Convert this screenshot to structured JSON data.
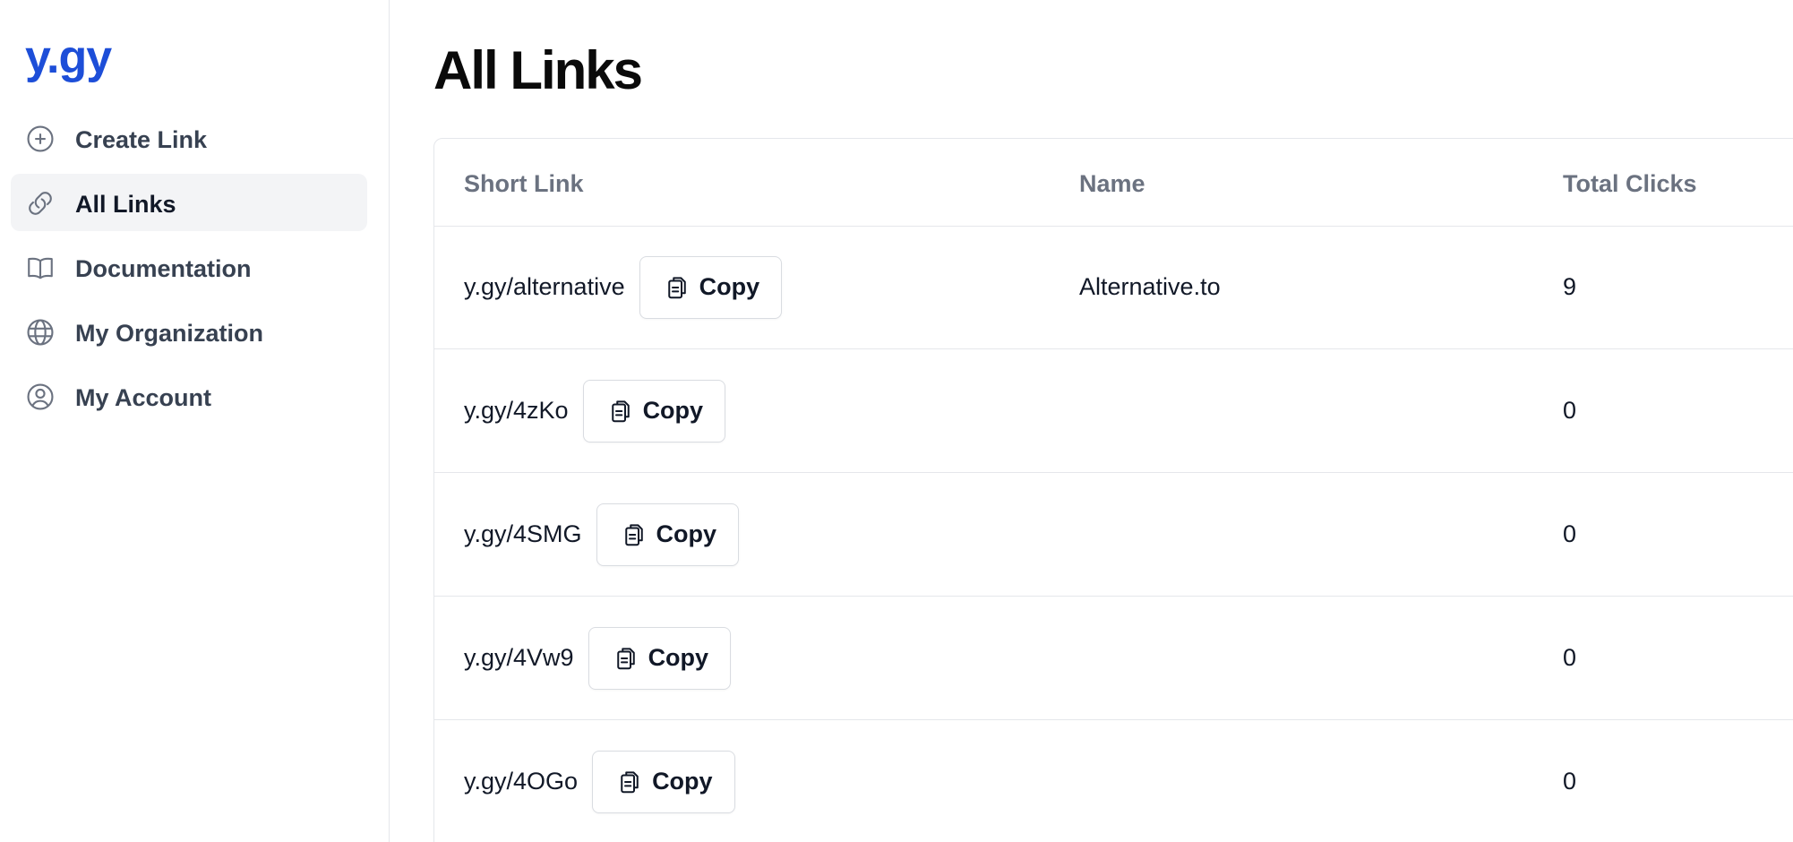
{
  "brand": {
    "logo": "y.gy",
    "accent": "#1d4ed8"
  },
  "sidebar": {
    "items": [
      {
        "label": "Create Link",
        "icon": "plus-circle-icon",
        "active": false
      },
      {
        "label": "All Links",
        "icon": "link-icon",
        "active": true
      },
      {
        "label": "Documentation",
        "icon": "book-icon",
        "active": false
      },
      {
        "label": "My Organization",
        "icon": "globe-icon",
        "active": false
      },
      {
        "label": "My Account",
        "icon": "user-circle-icon",
        "active": false
      }
    ]
  },
  "main": {
    "title": "All Links",
    "table": {
      "headers": {
        "short_link": "Short Link",
        "name": "Name",
        "total_clicks": "Total Clicks"
      },
      "copy_label": "Copy",
      "rows": [
        {
          "short_link": "y.gy/alternative",
          "name": "Alternative.to",
          "clicks": "9"
        },
        {
          "short_link": "y.gy/4zKo",
          "name": "",
          "clicks": "0"
        },
        {
          "short_link": "y.gy/4SMG",
          "name": "",
          "clicks": "0"
        },
        {
          "short_link": "y.gy/4Vw9",
          "name": "",
          "clicks": "0"
        },
        {
          "short_link": "y.gy/4OGo",
          "name": "",
          "clicks": "0"
        }
      ]
    }
  }
}
